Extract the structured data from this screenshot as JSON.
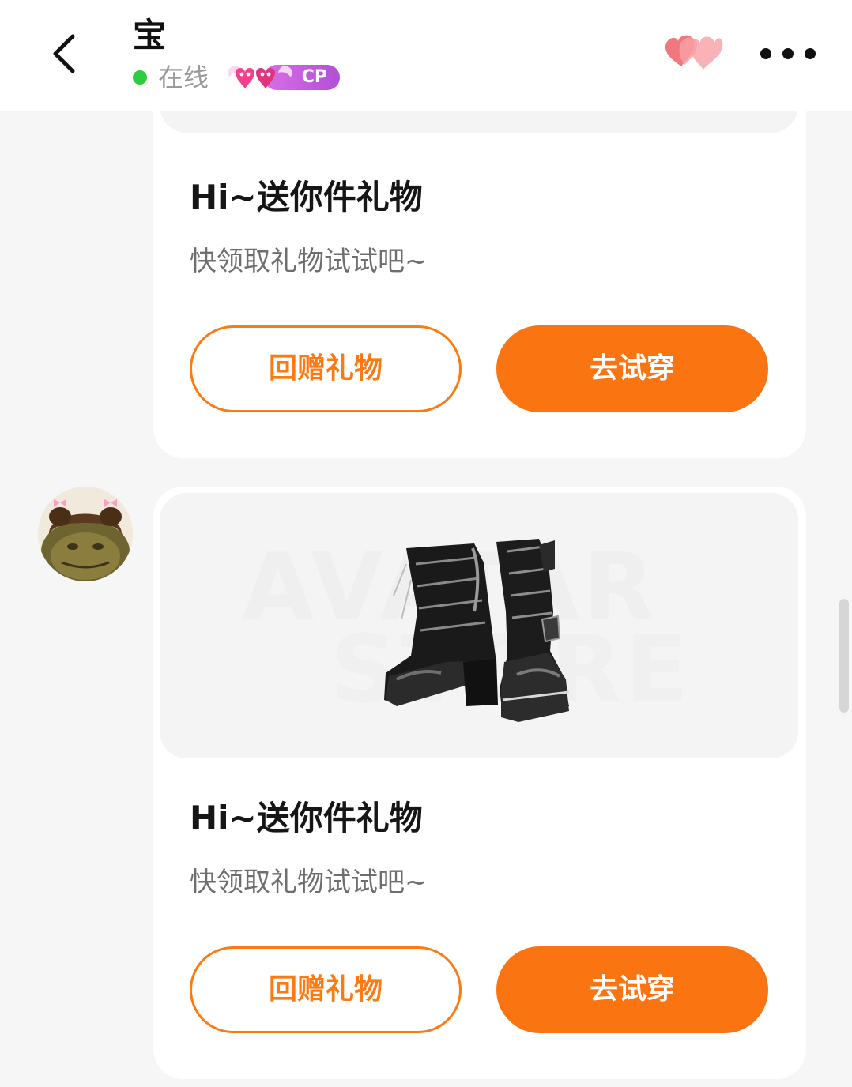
{
  "header": {
    "title": "宝",
    "status": "在线",
    "status_color": "#2ecc40",
    "cp_badge": "CP",
    "back_icon": "chevron-left-icon",
    "hearts_icon": "hearts-icon",
    "more_icon": "more-horizontal-icon"
  },
  "messages": [
    {
      "title": "Hi~送你件礼物",
      "subtitle": "快领取礼物试试吧~",
      "return_gift_label": "回赠礼物",
      "try_on_label": "去试穿"
    },
    {
      "title": "Hi~送你件礼物",
      "subtitle": "快领取礼物试试吧~",
      "image_watermark_line1": "AVATAR",
      "image_watermark_line2": "STORE",
      "return_gift_label": "回赠礼物",
      "try_on_label": "去试穿"
    }
  ],
  "colors": {
    "accent": "#fb7412",
    "page_background": "#f6f6f6",
    "card_background": "#ffffff"
  }
}
